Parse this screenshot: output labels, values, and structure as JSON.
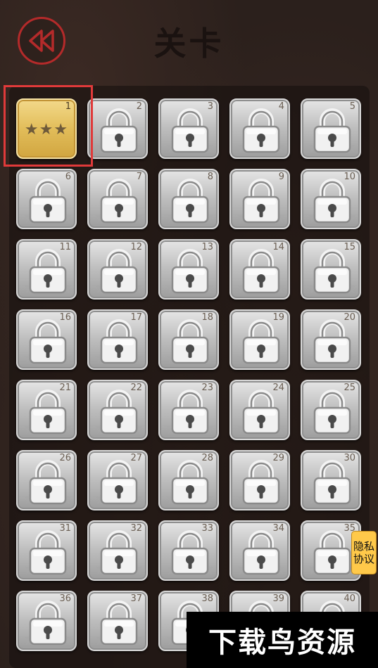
{
  "header": {
    "title": "关卡",
    "back_icon": "double-chevron-left-icon",
    "accent_color": "#b42a2a"
  },
  "levels": [
    {
      "number": "1",
      "state": "unlocked",
      "stars": 3,
      "stars_text": "★★★"
    },
    {
      "number": "2",
      "state": "locked"
    },
    {
      "number": "3",
      "state": "locked"
    },
    {
      "number": "4",
      "state": "locked"
    },
    {
      "number": "5",
      "state": "locked"
    },
    {
      "number": "6",
      "state": "locked"
    },
    {
      "number": "7",
      "state": "locked"
    },
    {
      "number": "8",
      "state": "locked"
    },
    {
      "number": "9",
      "state": "locked"
    },
    {
      "number": "10",
      "state": "locked"
    },
    {
      "number": "11",
      "state": "locked"
    },
    {
      "number": "12",
      "state": "locked"
    },
    {
      "number": "13",
      "state": "locked"
    },
    {
      "number": "14",
      "state": "locked"
    },
    {
      "number": "15",
      "state": "locked"
    },
    {
      "number": "16",
      "state": "locked"
    },
    {
      "number": "17",
      "state": "locked"
    },
    {
      "number": "18",
      "state": "locked"
    },
    {
      "number": "19",
      "state": "locked"
    },
    {
      "number": "20",
      "state": "locked"
    },
    {
      "number": "21",
      "state": "locked"
    },
    {
      "number": "22",
      "state": "locked"
    },
    {
      "number": "23",
      "state": "locked"
    },
    {
      "number": "24",
      "state": "locked"
    },
    {
      "number": "25",
      "state": "locked"
    },
    {
      "number": "26",
      "state": "locked"
    },
    {
      "number": "27",
      "state": "locked"
    },
    {
      "number": "28",
      "state": "locked"
    },
    {
      "number": "29",
      "state": "locked"
    },
    {
      "number": "30",
      "state": "locked"
    },
    {
      "number": "31",
      "state": "locked"
    },
    {
      "number": "32",
      "state": "locked"
    },
    {
      "number": "33",
      "state": "locked"
    },
    {
      "number": "34",
      "state": "locked"
    },
    {
      "number": "35",
      "state": "locked"
    },
    {
      "number": "36",
      "state": "locked"
    },
    {
      "number": "37",
      "state": "locked"
    },
    {
      "number": "38",
      "state": "locked"
    },
    {
      "number": "39",
      "state": "locked"
    },
    {
      "number": "40",
      "state": "locked"
    }
  ],
  "privacy_button": {
    "label": "隐私协议",
    "color": "#ffc94a"
  },
  "watermark": {
    "text": "下载鸟资源"
  },
  "colors": {
    "unlocked_tile": "#e2bd5a",
    "locked_tile": "#bdbdbd",
    "highlight": "#e03a3a"
  }
}
